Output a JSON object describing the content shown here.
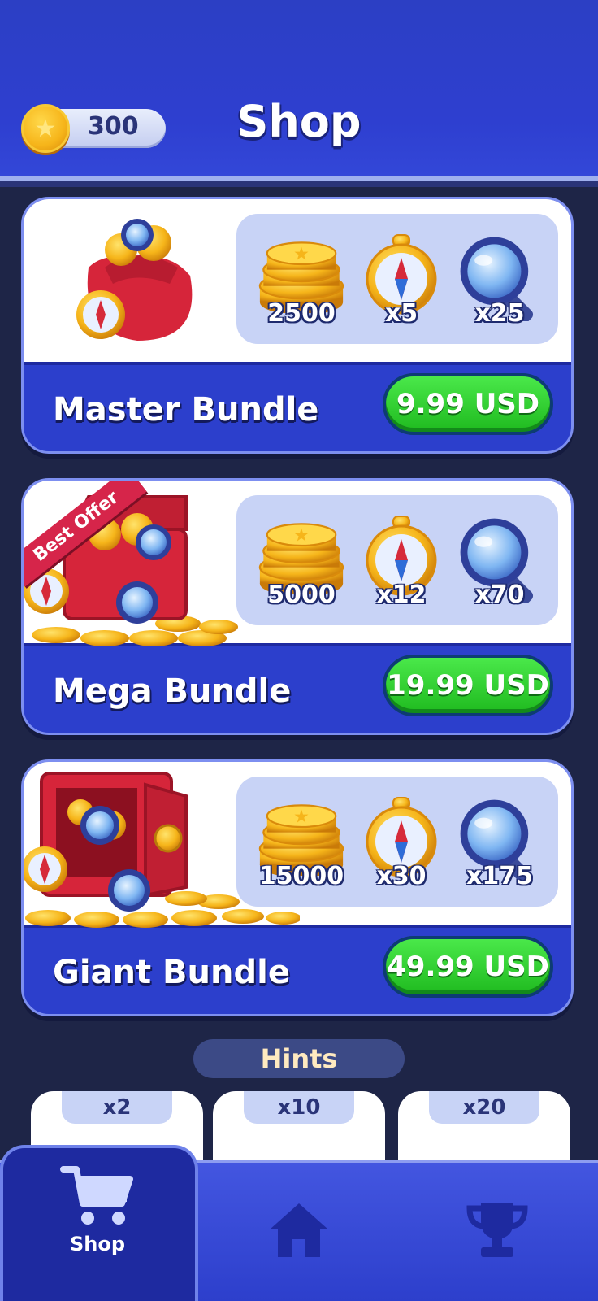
{
  "header": {
    "title": "Shop",
    "coin_balance": "300"
  },
  "bundles": [
    {
      "name": "Master Bundle",
      "price": "9.99 USD",
      "badge": "",
      "coins": "2500",
      "compass": "x5",
      "magnifier": "x25"
    },
    {
      "name": "Mega Bundle",
      "price": "19.99 USD",
      "badge": "Best Offer",
      "coins": "5000",
      "compass": "x12",
      "magnifier": "x70"
    },
    {
      "name": "Giant Bundle",
      "price": "49.99 USD",
      "badge": "",
      "coins": "15000",
      "compass": "x30",
      "magnifier": "x175"
    }
  ],
  "hints": {
    "title": "Hints",
    "cards": [
      "x2",
      "x10",
      "x20"
    ]
  },
  "nav": {
    "shop_label": "Shop",
    "home_icon": "home-icon",
    "trophy_icon": "trophy-icon",
    "cart_icon": "cart-icon"
  },
  "colors": {
    "header_blue": "#2e3fd0",
    "buy_green": "#1fba1f",
    "badge_red": "#d6254a",
    "background": "#1e2547"
  }
}
